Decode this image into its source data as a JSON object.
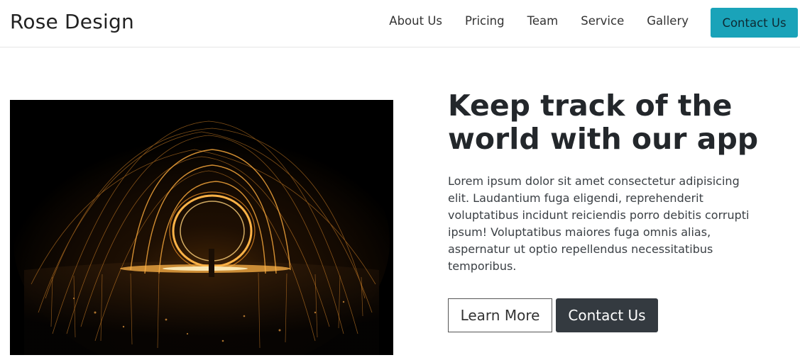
{
  "navbar": {
    "brand": "Rose Design",
    "links": [
      "About Us",
      "Pricing",
      "Team",
      "Service",
      "Gallery"
    ],
    "cta_label": "Contact Us",
    "cta_color": "#1aa3b9"
  },
  "hero": {
    "image_icon": "steel-wool-fire-photo",
    "title": "Keep track of the world with our app",
    "text": "Lorem ipsum dolor sit amet consectetur adipisicing elit. Laudantium fuga eligendi, reprehenderit voluptatibus incidunt reiciendis porro debitis corrupti ipsum! Voluptatibus maiores fuga omnis alias, aspernatur ut optio repellendus necessitatibus temporibus.",
    "primary_button": "Learn More",
    "secondary_button": "Contact Us",
    "dark_color": "#343a40"
  }
}
